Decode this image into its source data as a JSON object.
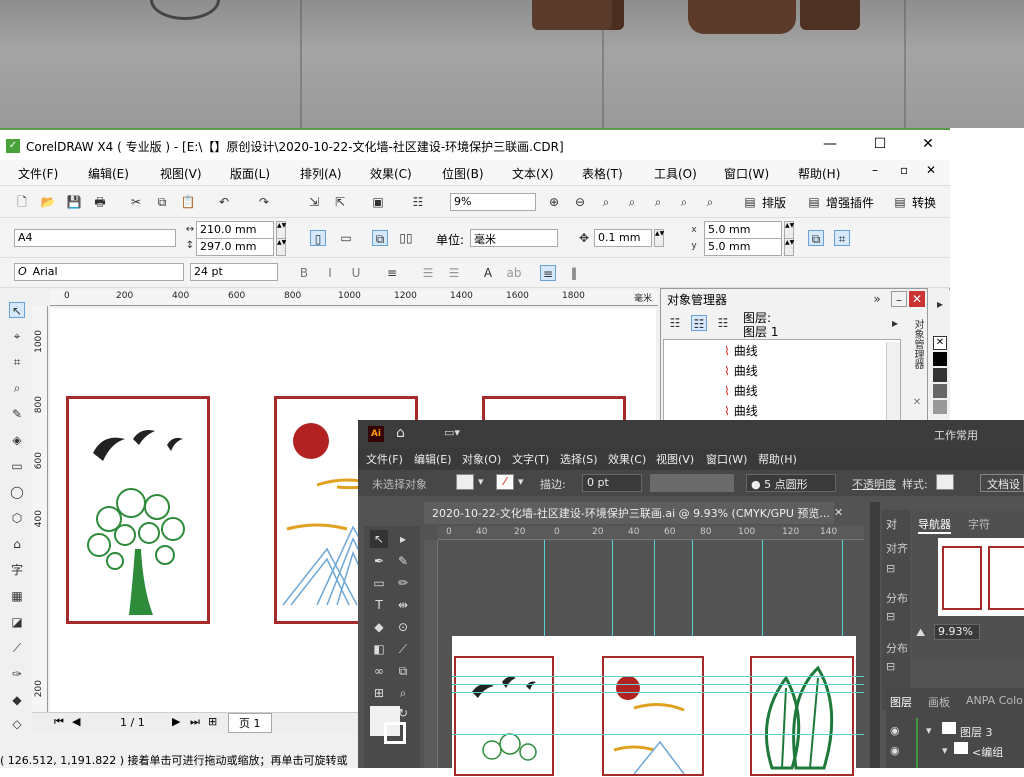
{
  "corel": {
    "title": "CorelDRAW X4 ( 专业版 ) - [E:\\【】原创设计\\2020-10-22-文化墙-社区建设-环境保护三联画.CDR]",
    "menu": [
      "文件(F)",
      "编辑(E)",
      "视图(V)",
      "版面(L)",
      "排列(A)",
      "效果(C)",
      "位图(B)",
      "文本(X)",
      "表格(T)",
      "工具(O)",
      "窗口(W)",
      "帮助(H)"
    ],
    "zoom": "9%",
    "toolbar_labels": {
      "typeset": "排版",
      "plugins": "增强插件",
      "convert": "转换"
    },
    "page_size": "A4",
    "width": "210.0 mm",
    "height": "297.0 mm",
    "units_label": "单位:",
    "units": "毫米",
    "nudge": "0.1 mm",
    "dup_x": "5.0 mm",
    "dup_y": "5.0 mm",
    "font": "Arial",
    "font_size": "24 pt",
    "ruler_h": [
      "0",
      "200",
      "400",
      "600",
      "800",
      "1000",
      "1200",
      "1400",
      "1600",
      "1800"
    ],
    "ruler_h_unit": "毫米",
    "ruler_v": [
      "1000",
      "800",
      "600",
      "400",
      "200"
    ],
    "page_nav": "1 / 1",
    "page_tab": "页 1",
    "status": "( 126.512, 1,191.822 )  接着单击可进行拖动或缩放；再单击可旋转或",
    "object_manager": {
      "title": "对象管理器",
      "layer_label": "图层:",
      "layer_name": "图层 1",
      "items": [
        "曲线",
        "曲线",
        "曲线",
        "曲线"
      ],
      "side_tab": "对象管理器"
    }
  },
  "ai": {
    "menu": [
      "文件(F)",
      "编辑(E)",
      "对象(O)",
      "文字(T)",
      "选择(S)",
      "效果(C)",
      "视图(V)",
      "窗口(W)",
      "帮助(H)"
    ],
    "workspace": "工作常用",
    "no_selection": "未选择对象",
    "stroke_label": "描边:",
    "stroke_value": "0 pt",
    "brush": "5 点圆形",
    "opacity_label": "不透明度",
    "style_label": "样式:",
    "doc_setup": "文档设",
    "doc_tab": "2020-10-22-文化墙-社区建设-环境保护三联画.ai @ 9.93% (CMYK/GPU 预览...",
    "ruler_h": [
      "0",
      "40",
      "20",
      "0",
      "20",
      "40",
      "60",
      "80",
      "100",
      "120",
      "140"
    ],
    "panel_tabs": {
      "navigator": "导航器",
      "character": "字符",
      "align": "对齐",
      "align_short": "对齐",
      "distribute": "分布",
      "distribute2": "分布",
      "obj": "对"
    },
    "nav_zoom": "9.93%",
    "layers_tabs": [
      "图层",
      "画板",
      "ANPA Colo"
    ],
    "layers": [
      "图层 3",
      "<编组"
    ]
  }
}
